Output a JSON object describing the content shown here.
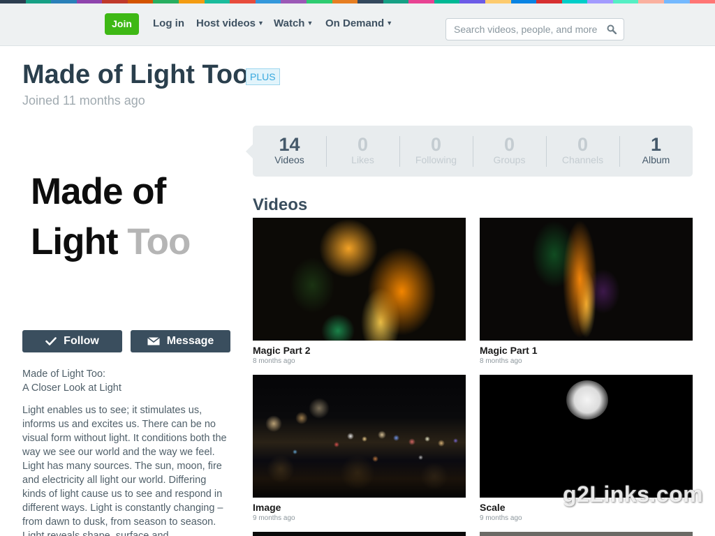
{
  "nav": {
    "join": "Join",
    "login": "Log in",
    "host_videos": "Host videos",
    "watch": "Watch",
    "on_demand": "On Demand",
    "search_placeholder": "Search videos, people, and more",
    "strip_colors": [
      "#2c3e50",
      "#16a085",
      "#2980b9",
      "#8e44ad",
      "#c0392b",
      "#d35400",
      "#27ae60",
      "#f39c12",
      "#1abc9c",
      "#e74c3c",
      "#3498db",
      "#9b59b6",
      "#2ecc71",
      "#e67e22",
      "#34495e",
      "#16a085",
      "#e84393",
      "#00b894",
      "#6c5ce7",
      "#fdcb6e",
      "#0984e3",
      "#d63031",
      "#00cec9",
      "#a29bfe",
      "#55efc4",
      "#fab1a0",
      "#74b9ff",
      "#ff7675"
    ]
  },
  "profile": {
    "name": "Made of Light Too",
    "badge": "PLUS",
    "joined": "Joined 11 months ago",
    "avatar_line1": "Made of",
    "avatar_line2_a": "Light",
    "avatar_line2_b": "Too",
    "follow": "Follow",
    "message": "Message",
    "bio_p1_l1": "Made of Light Too:",
    "bio_p1_l2": "A Closer Look at Light",
    "bio_p2": "Light enables us to see; it stimulates us, informs us and excites us. There can be no visual form without light. It conditions both the way we see our world and the way we feel. Light has many sources. The sun, moon, fire and electricity all light our world. Differing kinds of light cause us to see and respond in different ways. Light is constantly changing – from dawn to dusk, from season to season. Light reveals shape, surface and"
  },
  "stats": [
    {
      "num": "14",
      "label": "Videos",
      "active": true
    },
    {
      "num": "0",
      "label": "Likes",
      "active": false
    },
    {
      "num": "0",
      "label": "Following",
      "active": false
    },
    {
      "num": "0",
      "label": "Groups",
      "active": false
    },
    {
      "num": "0",
      "label": "Channels",
      "active": false
    },
    {
      "num": "1",
      "label": "Album",
      "active": true
    }
  ],
  "videos_heading": "Videos",
  "videos": [
    {
      "title": "Magic Part 2",
      "date": "8 months ago"
    },
    {
      "title": "Magic Part 1",
      "date": "8 months ago"
    },
    {
      "title": "Image",
      "date": "9 months ago"
    },
    {
      "title": "Scale",
      "date": "9 months ago"
    }
  ],
  "watermark": "g2Links.com"
}
